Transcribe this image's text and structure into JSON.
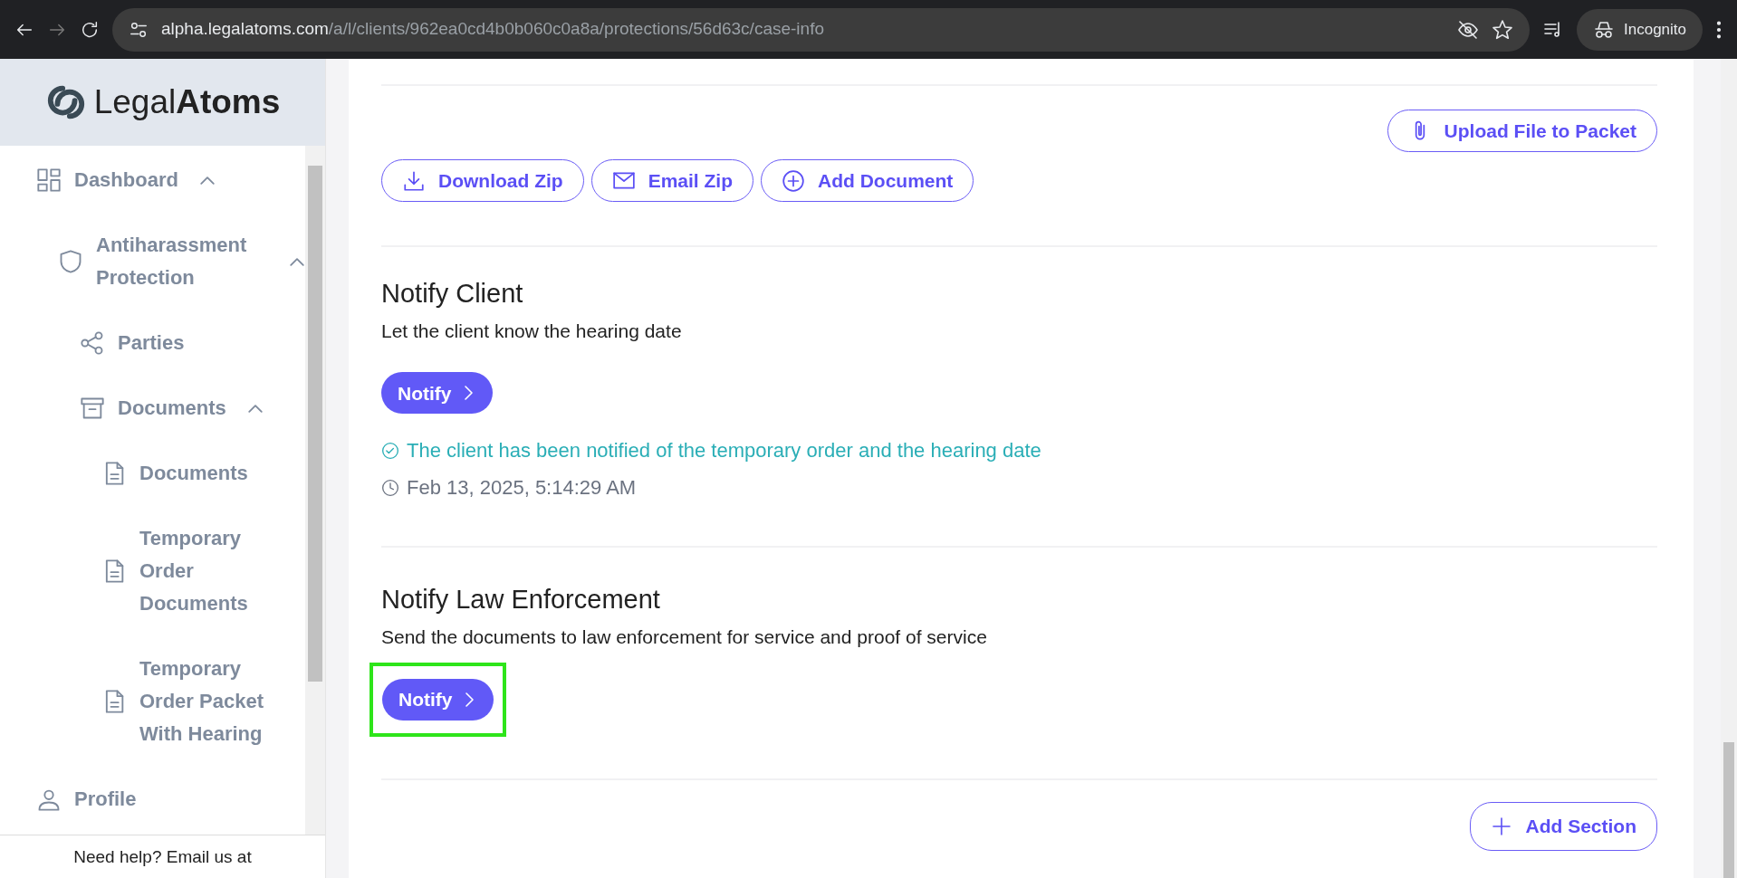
{
  "browser": {
    "url_host": "alpha.legalatoms.com",
    "url_path": "/a/l/clients/962ea0cd4b0b060c0a8a/protections/56d63c/case-info",
    "profile": "Incognito"
  },
  "sidebar": {
    "logo": "Legal**Atoms**",
    "nav": [
      {
        "label": "Dashboard",
        "expanded": true,
        "children": [
          {
            "label": "Antiharassment Protection",
            "expanded": true,
            "children": [
              {
                "label": "Parties"
              },
              {
                "label": "Documents",
                "expanded": true,
                "children": [
                  {
                    "label": "Documents"
                  },
                  {
                    "label": "Temporary Order Documents"
                  },
                  {
                    "label": "Temporary Order Packet With Hearing"
                  }
                ]
              }
            ]
          }
        ]
      },
      {
        "label": "Profile"
      }
    ],
    "help_text": "Need help? Email us at"
  },
  "main": {
    "upload_button": "Upload File to Packet",
    "doc_buttons": [
      {
        "label": "Download Zip"
      },
      {
        "label": "Email Zip"
      },
      {
        "label": "Add Document"
      }
    ],
    "sections": [
      {
        "title": "Notify Client",
        "description": "Let the client know the hearing date",
        "button": {
          "label": "Notify",
          "highlighted": false
        },
        "status": "The client has been notified of the temporary order and the hearing date",
        "timestamp": "Feb 13, 2025, 5:14:29 AM"
      },
      {
        "title": "Notify Law Enforcement",
        "description": "Send the documents to law enforcement for service and proof of service",
        "button": {
          "label": "Notify",
          "highlighted": true
        }
      }
    ],
    "add_section_button": "Add Section"
  }
}
